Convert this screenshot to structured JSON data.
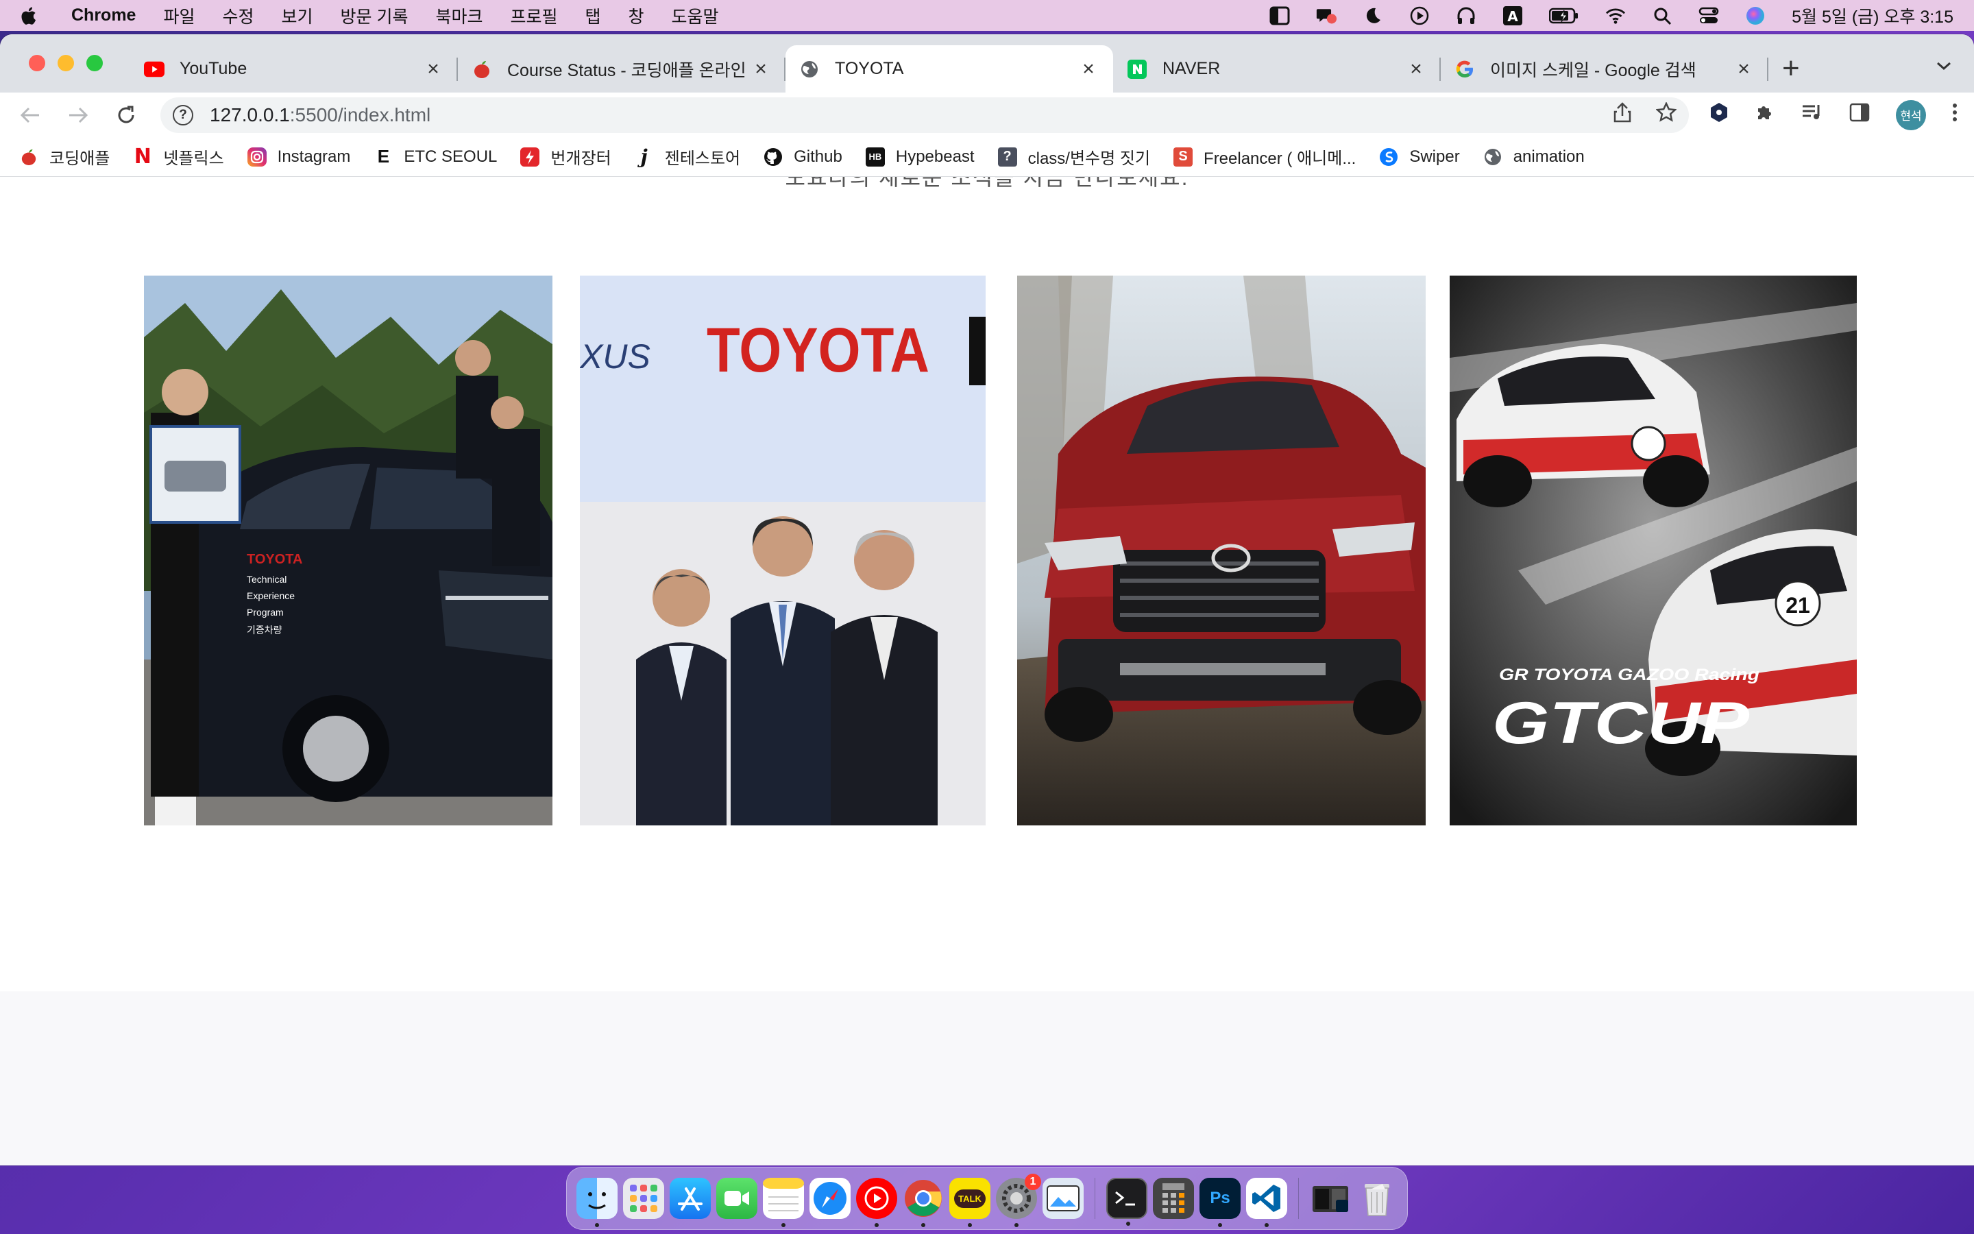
{
  "menubar": {
    "app_name": "Chrome",
    "menus": [
      "파일",
      "수정",
      "보기",
      "방문 기록",
      "북마크",
      "프로필",
      "탭",
      "창",
      "도움말"
    ],
    "clock": "5월 5일 (금) 오후 3:15",
    "status_icons": [
      "sidebar-icon",
      "chat-icon",
      "moon-icon",
      "play-icon",
      "headphones-icon",
      "input-source-icon",
      "battery-icon",
      "wifi-icon",
      "search-icon",
      "control-center-icon",
      "siri-icon"
    ]
  },
  "tabs": [
    {
      "title": "YouTube",
      "favicon": "youtube-icon",
      "active": false
    },
    {
      "title": "Course Status - 코딩애플 온라인 강",
      "favicon": "apple-logo-icon",
      "active": false
    },
    {
      "title": "TOYOTA",
      "favicon": "globe-icon",
      "active": true
    },
    {
      "title": "NAVER",
      "favicon": "naver-icon",
      "active": false
    },
    {
      "title": "이미지 스케일 - Google 검색",
      "favicon": "google-icon",
      "active": false
    }
  ],
  "toolbar": {
    "url_host": "127.0.0.1",
    "url_path": ":5500/index.html",
    "profile_label": "현석"
  },
  "bookmarks": [
    {
      "label": "코딩애플",
      "icon": "apple-logo-icon"
    },
    {
      "label": "넷플릭스",
      "icon": "netflix-icon"
    },
    {
      "label": "Instagram",
      "icon": "instagram-icon"
    },
    {
      "label": "ETC SEOUL",
      "icon": "etc-icon"
    },
    {
      "label": "번개장터",
      "icon": "bolt-icon"
    },
    {
      "label": "젠테스토어",
      "icon": "j-icon"
    },
    {
      "label": "Github",
      "icon": "github-icon"
    },
    {
      "label": "Hypebeast",
      "icon": "hypebeast-icon"
    },
    {
      "label": "class/변수명 짓기",
      "icon": "question-icon"
    },
    {
      "label": "Freelancer ( 애니메...",
      "icon": "freelancer-icon"
    },
    {
      "label": "Swiper",
      "icon": "swiper-icon"
    },
    {
      "label": "animation",
      "icon": "globe-icon"
    }
  ],
  "page": {
    "subtitle": "도요타의 새로운 소식을 지금 만나보세요.",
    "news": [
      {
        "name": "technical-experience-program",
        "sign_text": "TOYOTA Technical Experience Program 기증차량"
      },
      {
        "name": "toyota-executives",
        "logo_left": "XUS",
        "logo_text": "TOYOTA"
      },
      {
        "name": "rav4-snow"
      },
      {
        "name": "gt-cup",
        "brand_text": "GR TOYOTA GAZOO Racing",
        "title_text": "GTCUP",
        "car_number": "21"
      }
    ]
  },
  "dock": {
    "apps": [
      "finder-icon",
      "launchpad-icon",
      "app-store-icon",
      "facetime-icon",
      "notes-icon",
      "safari-icon",
      "youtube-music-icon",
      "chrome-icon",
      "kakaotalk-icon",
      "system-settings-icon",
      "preview-icon",
      "terminal-icon",
      "calculator-icon",
      "photoshop-icon",
      "vscode-icon"
    ],
    "extras": [
      "photoshop-folder-icon",
      "trash-icon"
    ],
    "kakao_label": "TALK",
    "ps_label": "Ps",
    "settings_badge": "1"
  }
}
